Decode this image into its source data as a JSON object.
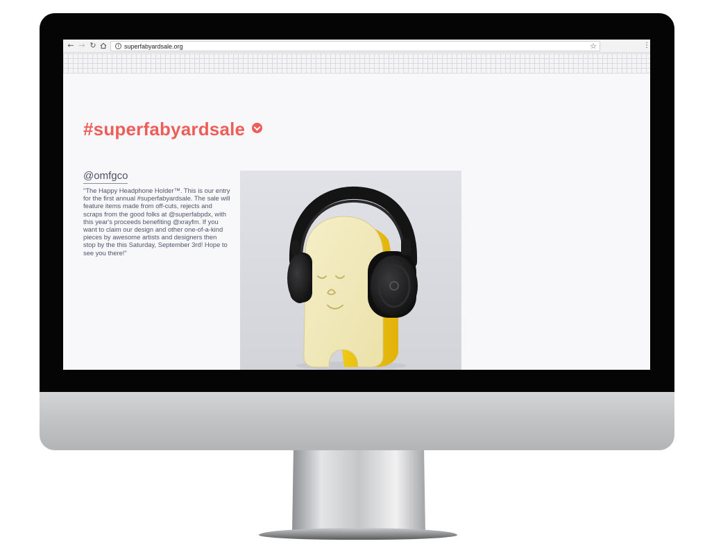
{
  "browser": {
    "url": "superfabyardsale.org",
    "back_icon": "arrow-left-icon",
    "forward_icon": "arrow-right-icon",
    "reload_icon": "reload-icon",
    "home_icon": "home-icon",
    "info_icon": "info-icon",
    "bookmark_icon": "star-icon",
    "menu_icon": "kebab-menu-icon"
  },
  "page": {
    "title": "#superfabyardsale",
    "title_icon": "chevron-down-circle-icon",
    "accent_color": "#ee5e59",
    "post": {
      "handle": "@omfgco",
      "caption": "\"The Happy Headphone Holder™. This is our entry for the first annual #superfabyardsale. The sale will feature items made from off-cuts, rejects and scraps from the good folks at @superfabpdx, with this year's proceeds benefiting @xrayfm. If you want to claim our design and other one-of-a-kind pieces by awesome artists and designers then stop by the this Saturday, September 3rd! Hope to see you there!\""
    }
  }
}
